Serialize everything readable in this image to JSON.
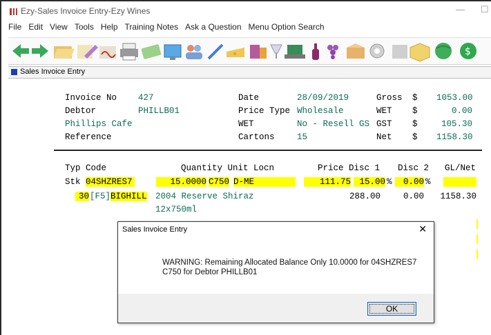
{
  "window": {
    "title": "Ezy-Sales Invoice Entry-Ezy Wines",
    "minimize": "—",
    "maximize": "☐"
  },
  "menu": [
    "File",
    "Edit",
    "View",
    "Tools",
    "Help",
    "Training Notes",
    "Ask a Question",
    "Menu Option Search"
  ],
  "toolbar_icons": [
    "back-icon",
    "forward-icon",
    "open-folder-icon",
    "edit-icon",
    "sign-icon",
    "printer-icon",
    "money-icon",
    "screen-icon",
    "people-icon",
    "pen-icon",
    "cheese-icon",
    "wine-icon",
    "glass-icon",
    "computer-icon",
    "bottle-icon",
    "grapes-icon",
    "box-icon",
    "settings-icon",
    "grey-box-icon",
    "cube-icon",
    "globe-icon",
    "dollar-icon"
  ],
  "mdi": {
    "title": "Sales Invoice Entry"
  },
  "header": {
    "invoice_no_label": "Invoice No",
    "invoice_no": "427",
    "debtor_label": "Debtor",
    "debtor": "PHILLB01",
    "debtor_name": "Phillips Cafe",
    "reference_label": "Reference",
    "date_label": "Date",
    "date": "28/09/2019",
    "price_type_label": "Price Type",
    "price_type": "Wholesale",
    "wet_label": "WET",
    "wet": "No - Resell GS",
    "cartons_label": "Cartons",
    "cartons": "15",
    "gross_label": "Gross",
    "gross_cur": "$",
    "gross": "1053.00",
    "wet_total_label": "WET",
    "wet_total_cur": "$",
    "wet_total": "0.00",
    "gst_label": "GST",
    "gst_cur": "$",
    "gst": "105.30",
    "net_label": "Net",
    "net_cur": "$",
    "net": "1158.30"
  },
  "line_headers": {
    "typ_code": "Typ Code",
    "qty_unit_locn": "Quantity Unit Locn",
    "price_disc1": "Price Disc 1",
    "disc2": "Disc 2",
    "glnet": "GL/Net"
  },
  "line": {
    "typ": "Stk",
    "code": "04SHZRES7",
    "quantity": "15.0000",
    "unit": "C750",
    "locn": "D-ME",
    "price": "111.75",
    "disc1": "15.00",
    "pct1": "%",
    "disc2": "0.00",
    "pct2": "%",
    "sub_num": "30",
    "sub_key": "[F5]",
    "sub_code": "BIGHILL",
    "desc": "2004 Reserve Shiraz",
    "unit_price": "288.00",
    "sub_disc": "0.00",
    "net": "1158.30",
    "pack": "12x750ml"
  },
  "dialog": {
    "title": "Sales Invoice Entry",
    "close": "✕",
    "message_line1": "WARNING: Remaining Allocated Balance Only 10.0000 for 04SHZRES7",
    "message_line2": "C750 for Debtor  PHILLB01",
    "ok": "OK"
  }
}
